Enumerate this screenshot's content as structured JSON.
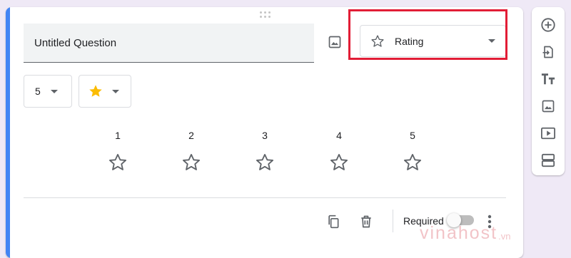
{
  "question": {
    "title": "Untitled Question"
  },
  "type_select": {
    "label": "Rating"
  },
  "scale_select": {
    "value": "5"
  },
  "rating_icon": "star-icon",
  "rating": {
    "labels": [
      "1",
      "2",
      "3",
      "4",
      "5"
    ]
  },
  "footer": {
    "required_label": "Required",
    "required_on": false
  },
  "watermark": {
    "text": "vinahost",
    "tld": ".vn"
  },
  "colors": {
    "accent": "#4285f4",
    "highlight": "#e21d36",
    "star_fill": "#fbbc04",
    "background": "#efe9f6"
  }
}
